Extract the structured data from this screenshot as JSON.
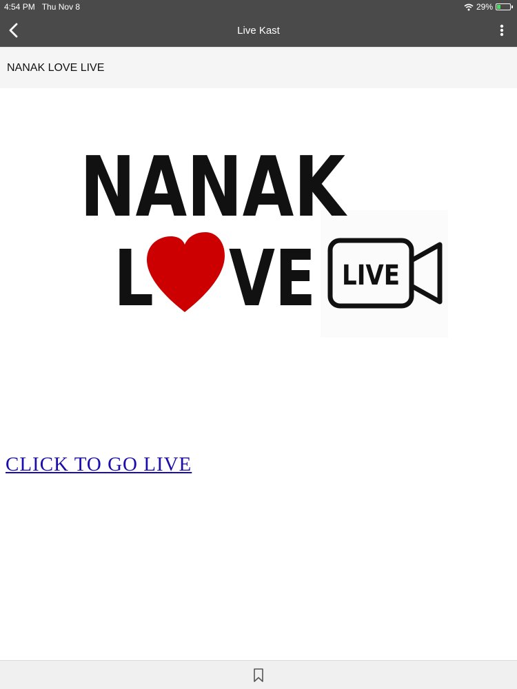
{
  "status_bar": {
    "time": "4:54 PM",
    "date": "Thu Nov 8",
    "battery": "29%",
    "battery_level": 0.29,
    "battery_color": "#4cd964",
    "wifi_icon": "wifi-icon",
    "battery_icon": "battery-icon"
  },
  "nav": {
    "title": "Live Kast",
    "back_icon": "chevron-left-icon",
    "more_icon": "more-vertical-icon",
    "background": "#4a4a4a"
  },
  "page": {
    "header_title": "NANAK LOVE LIVE",
    "logo": {
      "line1": "NANAK",
      "line2_left": "L",
      "line2_right": "VE",
      "badge_text": "LIVE",
      "heart_color": "#cc0000"
    },
    "link_text": "CLICK TO GO LIVE",
    "link_color": "#1a0dab"
  },
  "bottom_bar": {
    "bookmark_icon": "bookmark-icon"
  }
}
